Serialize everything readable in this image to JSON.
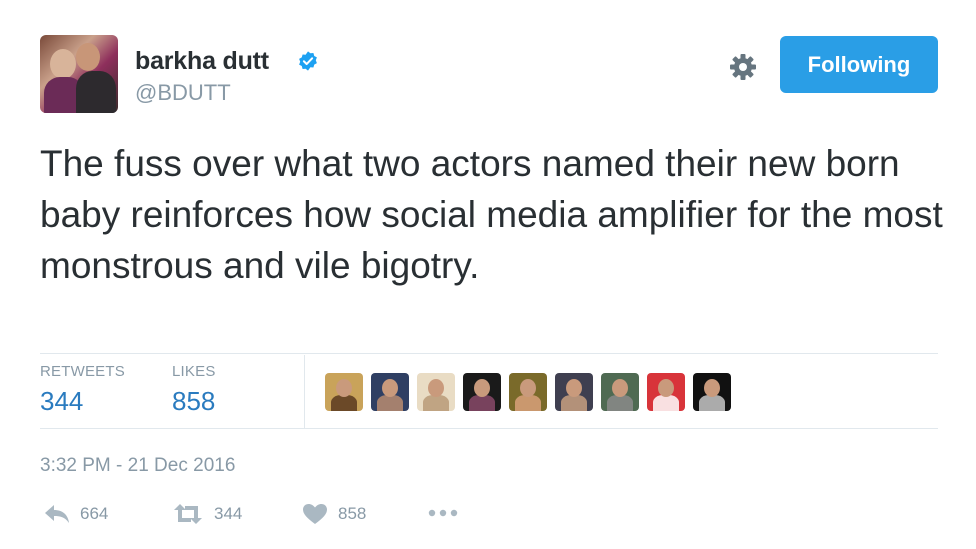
{
  "user": {
    "name": "barkha dutt",
    "handle": "@BDUTT",
    "verified": true
  },
  "follow_button": {
    "label": "Following",
    "color": "#2a9ee6"
  },
  "tweet": {
    "text": "The fuss over what two actors named their new born baby reinforces how social media amplifier for the most monstrous and vile bigotry."
  },
  "stats": {
    "retweets_label": "RETWEETS",
    "retweets_value": "344",
    "likes_label": "LIKES",
    "likes_value": "858"
  },
  "likers": [
    {
      "colors": [
        "#c9a35a",
        "#5a3a20"
      ]
    },
    {
      "colors": [
        "#2f3f63",
        "#b98c70"
      ]
    },
    {
      "colors": [
        "#e9dcc4",
        "#b89a78"
      ]
    },
    {
      "colors": [
        "#1a1a1a",
        "#8a4a6a"
      ]
    },
    {
      "colors": [
        "#7a6a2a",
        "#d8a07a"
      ]
    },
    {
      "colors": [
        "#3f3f50",
        "#c8a080"
      ]
    },
    {
      "colors": [
        "#4f6a52",
        "#8a8a8a"
      ]
    },
    {
      "colors": [
        "#d8343a",
        "#ffffff"
      ]
    },
    {
      "colors": [
        "#111111",
        "#c7c7c7"
      ]
    }
  ],
  "timestamp": "3:32 PM - 21 Dec 2016",
  "actions": {
    "reply_count": "664",
    "retweet_count": "344",
    "like_count": "858"
  },
  "icons": [
    "verified-badge-icon",
    "gear-icon",
    "reply-icon",
    "retweet-icon",
    "heart-icon",
    "more-icon"
  ]
}
